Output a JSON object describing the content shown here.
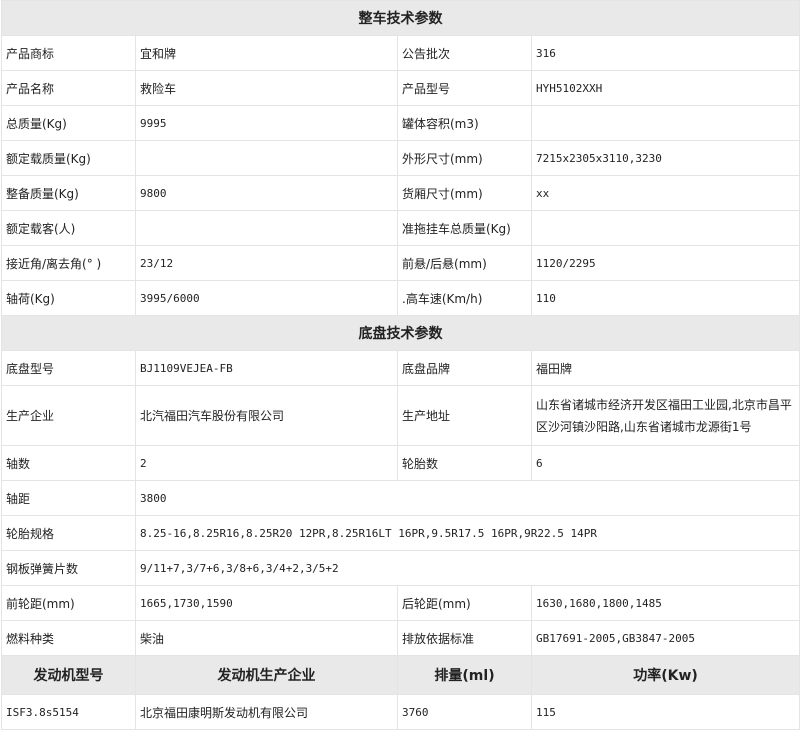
{
  "vehicle_section": {
    "title": "整车技术参数",
    "rows": [
      {
        "l1": "产品商标",
        "v1": "宜和牌",
        "l2": "公告批次",
        "v2": "316"
      },
      {
        "l1": "产品名称",
        "v1": "救险车",
        "l2": "产品型号",
        "v2": "HYH5102XXH"
      },
      {
        "l1": "总质量(Kg)",
        "v1": "9995",
        "l2": "罐体容积(m3)",
        "v2": ""
      },
      {
        "l1": "额定载质量(Kg)",
        "v1": "",
        "l2": "外形尺寸(mm)",
        "v2": "7215x2305x3110,3230"
      },
      {
        "l1": "整备质量(Kg)",
        "v1": "9800",
        "l2": "货厢尺寸(mm)",
        "v2": "xx"
      },
      {
        "l1": "额定载客(人)",
        "v1": "",
        "l2": "准拖挂车总质量(Kg)",
        "v2": ""
      },
      {
        "l1": "接近角/离去角(° )",
        "v1": "23/12",
        "l2": "前悬/后悬(mm)",
        "v2": "1120/2295"
      },
      {
        "l1": "轴荷(Kg)",
        "v1": "3995/6000",
        "l2": ".高车速(Km/h)",
        "v2": "110"
      }
    ]
  },
  "chassis_section": {
    "title": "底盘技术参数",
    "model_row": {
      "l1": "底盘型号",
      "v1": "BJ1109VEJEA-FB",
      "l2": "底盘品牌",
      "v2": "福田牌"
    },
    "maker_row": {
      "l1": "生产企业",
      "v1": "北汽福田汽车股份有限公司",
      "l2": "生产地址",
      "v2": "山东省诸城市经济开发区福田工业园,北京市昌平区沙河镇沙阳路,山东省诸城市龙源街1号"
    },
    "axle_row": {
      "l1": "轴数",
      "v1": "2",
      "l2": "轮胎数",
      "v2": "6"
    },
    "wheelbase_row": {
      "l1": "轴距",
      "v1": "3800"
    },
    "tire_row": {
      "l1": "轮胎规格",
      "v1": "8.25-16,8.25R16,8.25R20 12PR,8.25R16LT 16PR,9.5R17.5 16PR,9R22.5 14PR"
    },
    "spring_row": {
      "l1": "钢板弹簧片数",
      "v1": "9/11+7,3/7+6,3/8+6,3/4+2,3/5+2"
    },
    "track_row": {
      "l1": "前轮距(mm)",
      "v1": "1665,1730,1590",
      "l2": "后轮距(mm)",
      "v2": "1630,1680,1800,1485"
    },
    "fuel_row": {
      "l1": "燃料种类",
      "v1": "柴油",
      "l2": "排放依据标准",
      "v2": "GB17691-2005,GB3847-2005"
    }
  },
  "engine_section": {
    "headers": [
      "发动机型号",
      "发动机生产企业",
      "排量(ml)",
      "功率(Kw)"
    ],
    "row": [
      "ISF3.8s5154",
      "北京福田康明斯发动机有限公司",
      "3760",
      "115"
    ]
  }
}
